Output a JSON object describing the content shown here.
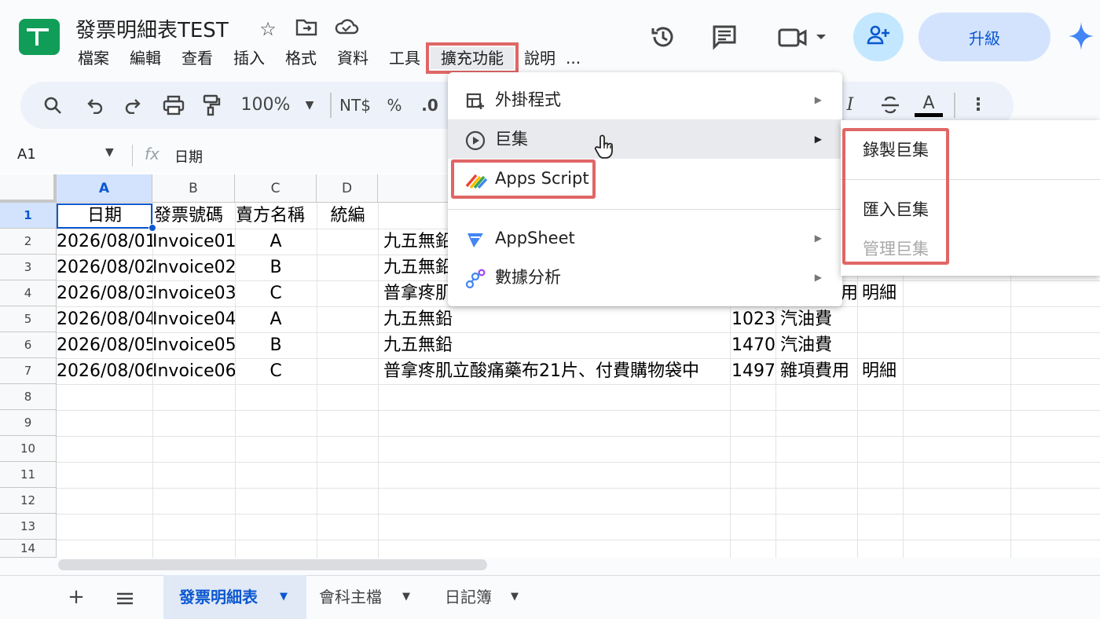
{
  "app": {
    "doc_title": "發票明細表TEST",
    "star_icon": "star-icon",
    "move_icon": "folder-move-icon",
    "cloud_icon": "cloud-saved-icon"
  },
  "menubar": {
    "items": [
      "檔案",
      "編輯",
      "查看",
      "插入",
      "格式",
      "資料",
      "工具",
      "擴充功能",
      "說明",
      "..."
    ],
    "active_index": 7
  },
  "header_right": {
    "upgrade_label": "升級",
    "history_icon": "history-icon",
    "comments_icon": "comments-icon",
    "meet_icon": "video-call-icon",
    "share_icon": "add-person-icon",
    "gemini_icon": "gemini-sparkle-icon"
  },
  "toolbar": {
    "zoom": "100%",
    "currency": "NT$",
    "percent": "%",
    "decimal": ".0",
    "italic": "I",
    "text_color": "A"
  },
  "formula_bar": {
    "cell_ref": "A1",
    "fx": "fx",
    "content": "日期"
  },
  "columns": [
    "A",
    "B",
    "C",
    "D"
  ],
  "rows": [
    "1",
    "2",
    "3",
    "4",
    "5",
    "6",
    "7",
    "8",
    "9",
    "10",
    "11",
    "12",
    "13",
    "14"
  ],
  "sheet": {
    "header": [
      "日期",
      "發票號碼",
      "賣方名稱",
      "統編"
    ],
    "rows": [
      {
        "date": "2026/08/01",
        "invoice": "Invoice01",
        "seller": "A",
        "item": "九五無鉛",
        "amount": "",
        "category": "",
        "note": ""
      },
      {
        "date": "2026/08/02",
        "invoice": "Invoice02",
        "seller": "B",
        "item": "九五無鉛",
        "amount": "",
        "category": "",
        "note": ""
      },
      {
        "date": "2026/08/03",
        "invoice": "Invoice03",
        "seller": "C",
        "item": "普拿疼肌",
        "amount": "",
        "category": "用",
        "note": "明細"
      },
      {
        "date": "2026/08/04",
        "invoice": "Invoice04",
        "seller": "A",
        "item": "九五無鉛",
        "amount": "1023",
        "category": "汽油費",
        "note": ""
      },
      {
        "date": "2026/08/05",
        "invoice": "Invoice05",
        "seller": "B",
        "item": "九五無鉛",
        "amount": "1470",
        "category": "汽油費",
        "note": ""
      },
      {
        "date": "2026/08/06",
        "invoice": "Invoice06",
        "seller": "C",
        "item": "普拿疼肌立酸痛藥布21片、付費購物袋中",
        "amount": "1497",
        "category": "雜項費用",
        "note": "明細"
      }
    ]
  },
  "extensions_menu": {
    "items": [
      {
        "label": "外掛程式",
        "icon": "addons-icon",
        "has_submenu": true
      },
      {
        "label": "巨集",
        "icon": "play-circle-icon",
        "has_submenu": true
      },
      {
        "label": "Apps Script",
        "icon": "apps-script-icon",
        "has_submenu": false
      },
      {
        "label": "AppSheet",
        "icon": "appsheet-icon",
        "has_submenu": true
      },
      {
        "label": "數據分析",
        "icon": "analytics-icon",
        "has_submenu": true
      }
    ],
    "hovered": "巨集"
  },
  "macros_submenu": {
    "items": [
      {
        "label": "錄製巨集",
        "enabled": true
      },
      {
        "label": "匯入巨集",
        "enabled": true
      },
      {
        "label": "管理巨集",
        "enabled": false
      }
    ]
  },
  "sheet_tabs": {
    "tabs": [
      "發票明細表",
      "會科主檔",
      "日記簿"
    ],
    "active_index": 0
  },
  "colors": {
    "accent": "#0b57d0",
    "highlight": "#e06666",
    "sheets_green": "#0f9d58"
  }
}
